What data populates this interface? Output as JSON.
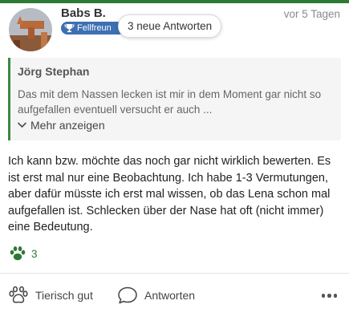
{
  "colors": {
    "brand_green": "#2d7a35",
    "badge_blue": "#3e6fb2",
    "quote_bar": "#3a8a3f"
  },
  "post": {
    "author": "Babs B.",
    "badge_label": "Fellfreun",
    "badge_icon": "trophy-icon",
    "timestamp": "vor 5 Tagen",
    "new_replies_pill": "3 neue Antworten",
    "quote": {
      "author": "Jörg Stephan",
      "text": "Das mit dem Nassen lecken ist mir in dem Moment gar nicht so aufgefallen eventuell versucht er auch ...",
      "expand_label": "Mehr anzeigen"
    },
    "body": "Ich kann bzw. möchte das noch gar nicht wirklich bewerten. Es ist erst mal nur eine Beobachtung. Ich habe 1-3 Vermutungen, aber dafür müsste ich erst mal wissen, ob das Lena schon mal aufgefallen ist. Schlecken über der Nase hat oft (nicht immer) eine Bedeutung.",
    "reaction_count": "3"
  },
  "actions": {
    "like_label": "Tierisch gut",
    "reply_label": "Antworten"
  }
}
